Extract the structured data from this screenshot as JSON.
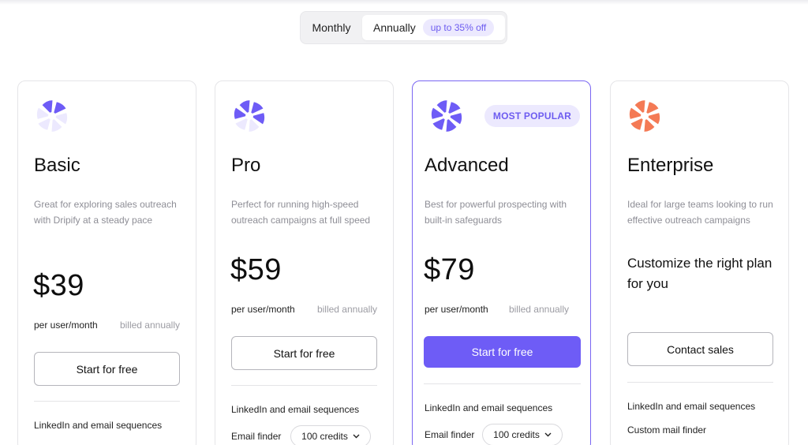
{
  "billing_toggle": {
    "monthly_label": "Monthly",
    "annually_label": "Annually",
    "discount_badge": "up to 35% off",
    "selected": "Annually"
  },
  "colors": {
    "accent": "#6e5cf6",
    "accent_light": "#ece9fe",
    "enterprise_logo": "#f47a55",
    "muted_text": "#8e8e96"
  },
  "plans": [
    {
      "name": "Basic",
      "logo_icon": "dripify-logo-icon",
      "description": "Great for exploring sales outreach with Dripify at a steady pace",
      "price": "$39",
      "per": "per user/month",
      "billed": "billed annually",
      "cta": "Start for free",
      "features": [
        "LinkedIn and email sequences"
      ]
    },
    {
      "name": "Pro",
      "logo_icon": "dripify-logo-icon",
      "description": "Perfect for running high-speed outreach campaigns at full speed",
      "price": "$59",
      "per": "per user/month",
      "billed": "billed annually",
      "cta": "Start for free",
      "features": [
        "LinkedIn and email sequences",
        "Email finder"
      ],
      "credits_option": "100 credits"
    },
    {
      "name": "Advanced",
      "logo_icon": "dripify-logo-icon",
      "badge": "MOST POPULAR",
      "description": "Best for powerful prospecting with built-in safeguards",
      "price": "$79",
      "per": "per user/month",
      "billed": "billed annually",
      "cta": "Start for free",
      "features": [
        "LinkedIn and email sequences",
        "Email finder"
      ],
      "credits_option": "100 credits"
    },
    {
      "name": "Enterprise",
      "logo_icon": "dripify-logo-icon",
      "description": "Ideal for large teams looking to run effective outreach campaigns",
      "custom_text": "Customize the right plan for you",
      "cta": "Contact sales",
      "features": [
        "LinkedIn and email sequences",
        "Custom mail finder"
      ]
    }
  ]
}
